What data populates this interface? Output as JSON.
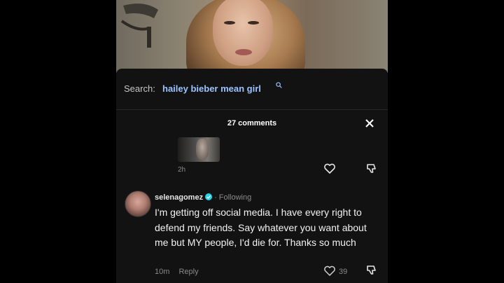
{
  "search": {
    "label": "Search:",
    "query": "hailey bieber mean girl",
    "icon": "search-icon"
  },
  "comments_header": {
    "count_text": "27 comments",
    "close_icon": "close-icon"
  },
  "reply_item": {
    "time": "2h"
  },
  "comment": {
    "username": "selenagomez",
    "verified": true,
    "relation": "Following",
    "text": "I'm getting off social media. I have every right to defend my friends. Say whatever you want about me but MY people, I'd die for. Thanks so much",
    "time": "10m",
    "reply_label": "Reply",
    "likes": "39"
  },
  "colors": {
    "background": "#000000",
    "sheet": "#121212",
    "search_query": "#9cc3ff",
    "verified_badge": "#20d5ec",
    "muted_text": "#8a8a8a"
  }
}
